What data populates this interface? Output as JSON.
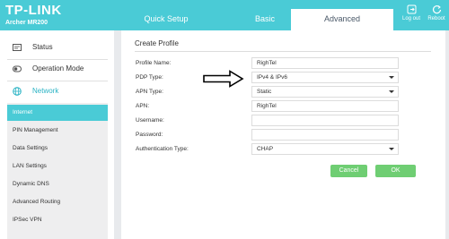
{
  "header": {
    "logo": "TP-LINK",
    "model": "Archer MR200",
    "tabs": {
      "quick_setup": "Quick Setup",
      "basic": "Basic",
      "advanced": "Advanced"
    },
    "logout_label": "Log out",
    "reboot_label": "Reboot",
    "accent_color": "#4acbd6"
  },
  "sidebar": {
    "items": [
      {
        "label": "Status",
        "icon": "status-icon"
      },
      {
        "label": "Operation Mode",
        "icon": "operation-mode-icon"
      },
      {
        "label": "Network",
        "icon": "network-globe-icon"
      }
    ],
    "sub_items": [
      "Internet",
      "PIN Management",
      "Data Settings",
      "LAN Settings",
      "Dynamic DNS",
      "Advanced Routing",
      "IPSec VPN"
    ],
    "active_sub": "Internet"
  },
  "form": {
    "title": "Create Profile",
    "labels": {
      "profile_name": "Profile Name:",
      "pdp_type": "PDP Type:",
      "apn_type": "APN Type:",
      "apn": "APN:",
      "username": "Username:",
      "password": "Password:",
      "auth_type": "Authentication Type:"
    },
    "values": {
      "profile_name": "RighTel",
      "pdp_type": "IPv4 & IPv6",
      "apn_type": "Static",
      "apn": "RighTel",
      "username": "",
      "password": "",
      "auth_type": "CHAP"
    },
    "cancel_label": "Cancel",
    "ok_label": "OK",
    "button_color": "#6fce73"
  }
}
